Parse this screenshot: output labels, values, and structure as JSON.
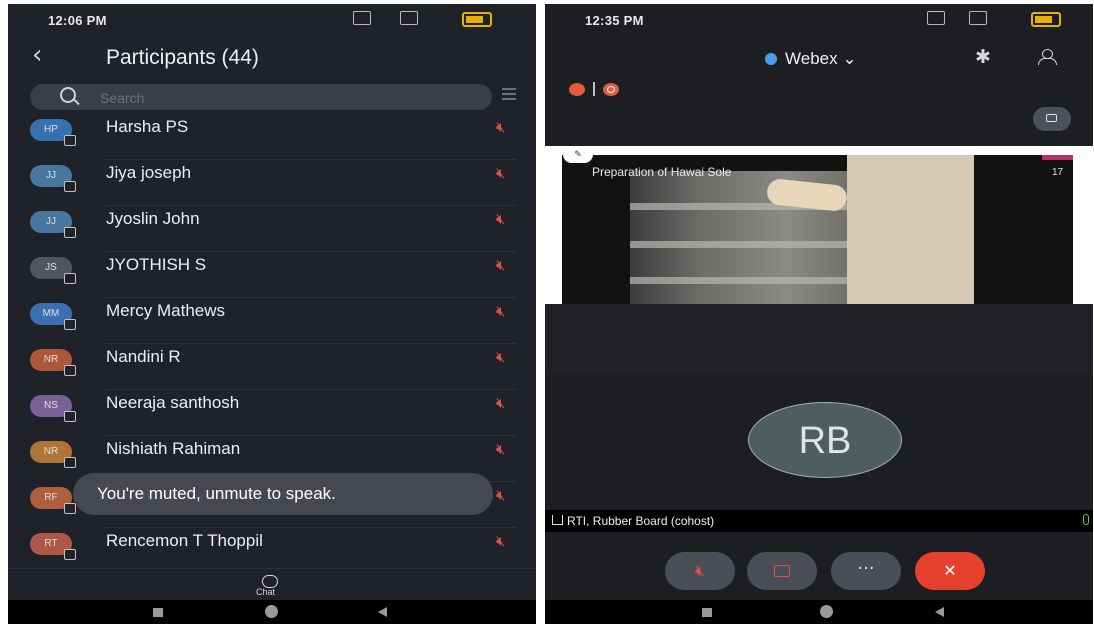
{
  "left": {
    "status": {
      "time": "12:06 PM"
    },
    "header": {
      "back_glyph": "‹",
      "title": "Participants (44)"
    },
    "search": {
      "placeholder": "Search"
    },
    "participants": [
      {
        "initials": "HP",
        "name": "Harsha PS",
        "color": "#3d7ec7"
      },
      {
        "initials": "JJ",
        "name": "Jiya joseph",
        "color": "#4f86b5"
      },
      {
        "initials": "JJ",
        "name": "Jyoslin John",
        "color": "#4f86b5"
      },
      {
        "initials": "JS",
        "name": "JYOTHISH S",
        "color": "#5a5f68"
      },
      {
        "initials": "MM",
        "name": "Mercy Mathews",
        "color": "#3f7ec9"
      },
      {
        "initials": "NR",
        "name": "Nandini R",
        "color": "#c8603c"
      },
      {
        "initials": "NS",
        "name": "Neeraja santhosh",
        "color": "#8d6aa8"
      },
      {
        "initials": "NR",
        "name": "Nishiath Rahiman",
        "color": "#c9843a"
      },
      {
        "initials": "RF",
        "name": "",
        "color": "#c86a45"
      },
      {
        "initials": "RT",
        "name": "Rencemon T Thoppil",
        "color": "#c8624d"
      }
    ],
    "toast": "You're muted, unmute to speak.",
    "tabbar": {
      "chat_label": "Chat"
    }
  },
  "right": {
    "status": {
      "time": "12:35 PM"
    },
    "header": {
      "brand": "Webex",
      "chevron": "⌄"
    },
    "share": {
      "caption": "Preparation of Hawai Sole",
      "slide_number": "17",
      "annot_badge": "✎"
    },
    "self_initials": "RB",
    "name_label": "RTI, Rubber Board (cohost)",
    "controls": {
      "more": "···",
      "leave": "✕"
    }
  },
  "colors": {
    "muted": "#e0514c",
    "leave": "#e8402f",
    "webex_blue": "#4a9ee8"
  }
}
